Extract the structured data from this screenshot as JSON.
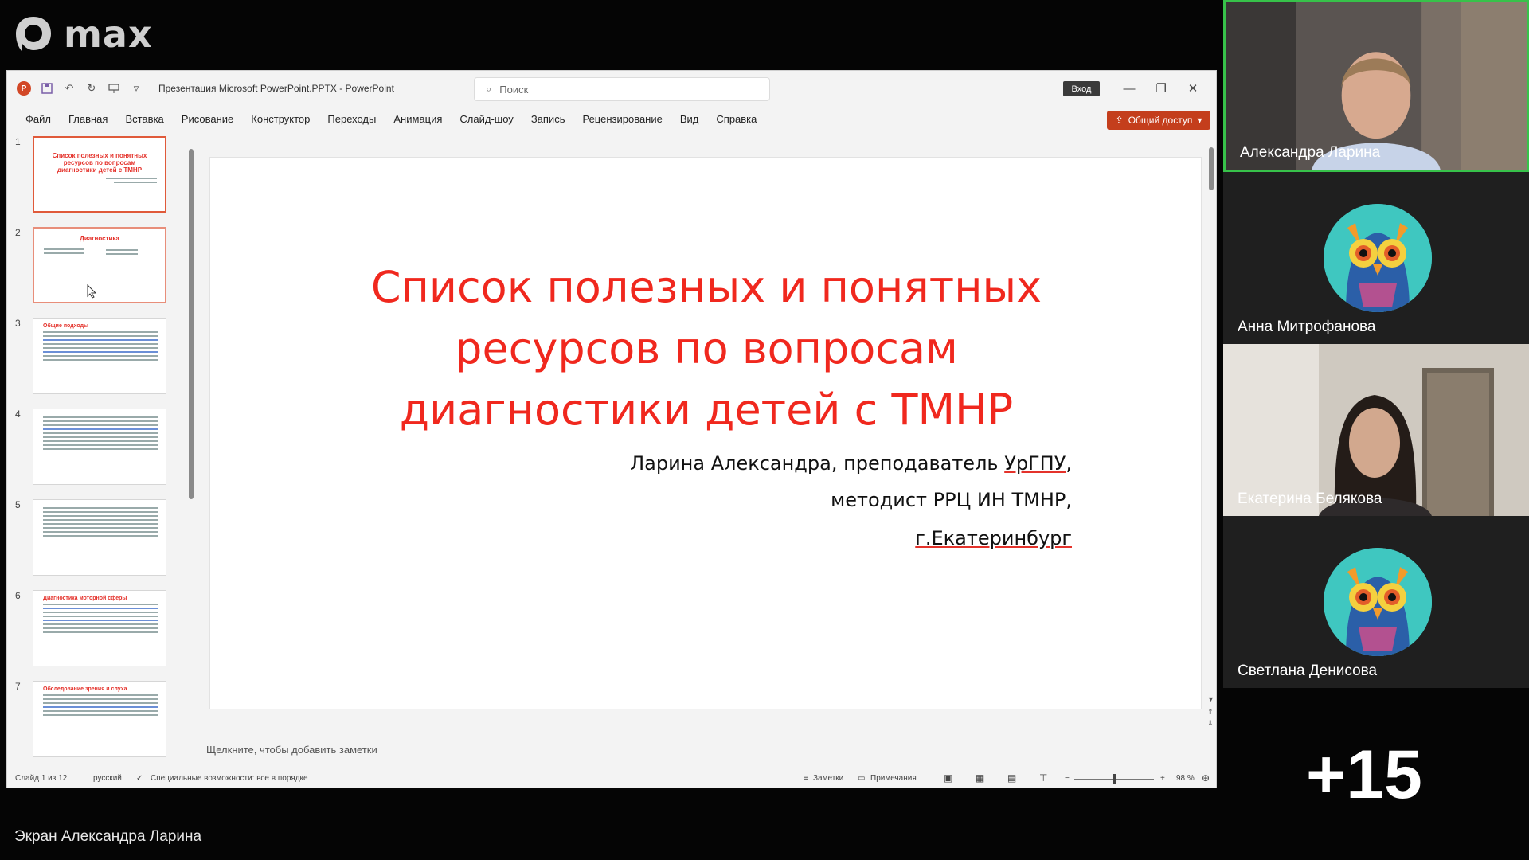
{
  "app": {
    "logo_text": "max"
  },
  "ppt": {
    "doc_title": "Презентация Microsoft PowerPoint.PPTX  -  PowerPoint",
    "search_placeholder": "Поиск",
    "signin_label": "Вход",
    "menu": [
      "Файл",
      "Главная",
      "Вставка",
      "Рисование",
      "Конструктор",
      "Переходы",
      "Анимация",
      "Слайд-шоу",
      "Запись",
      "Рецензирование",
      "Вид",
      "Справка"
    ],
    "share_label": "Общий доступ",
    "thumbnails": [
      {
        "num": "1",
        "title": "Список полезных и понятных ресурсов по вопросам диагностики детей с ТМНР"
      },
      {
        "num": "2",
        "title": "Диагностика"
      },
      {
        "num": "3",
        "title": "Общие подходы"
      },
      {
        "num": "4",
        "title": ""
      },
      {
        "num": "5",
        "title": ""
      },
      {
        "num": "6",
        "title": "Диагностика моторной сферы"
      },
      {
        "num": "7",
        "title": "Обследование зрения и слуха"
      }
    ],
    "slide": {
      "title_line1": "Список полезных и понятных",
      "title_line2": "ресурсов по вопросам",
      "title_line3": "диагностики детей с ТМНР",
      "sub_line1_a": "Ларина Александра, преподаватель ",
      "sub_line1_b": "УрГПУ",
      "sub_line1_c": ",",
      "sub_line2": "методист РРЦ ИН ТМНР,",
      "sub_line3": "г.Екатеринбург"
    },
    "notes_placeholder": "Щелкните, чтобы добавить заметки",
    "status": {
      "slide_count": "Слайд 1 из 12",
      "language": "русский",
      "accessibility": "Специальные возможности: все в порядке",
      "notes_btn": "Заметки",
      "comments_btn": "Примечания",
      "zoom_minus": "−",
      "zoom_plus": "+",
      "zoom": "98 %"
    }
  },
  "participants": [
    {
      "name": "Александра Ларина",
      "type": "video",
      "active": true
    },
    {
      "name": "Анна Митрофанова",
      "type": "avatar"
    },
    {
      "name": "Екатерина Белякова",
      "type": "video"
    },
    {
      "name": "Светлана Денисова",
      "type": "avatar"
    }
  ],
  "more_participants": "+15",
  "screen_share_label": "Экран Александра Ларина",
  "colors": {
    "accent_red": "#f0281e",
    "share_btn": "#c43e1c",
    "active_border": "#37c24a"
  }
}
